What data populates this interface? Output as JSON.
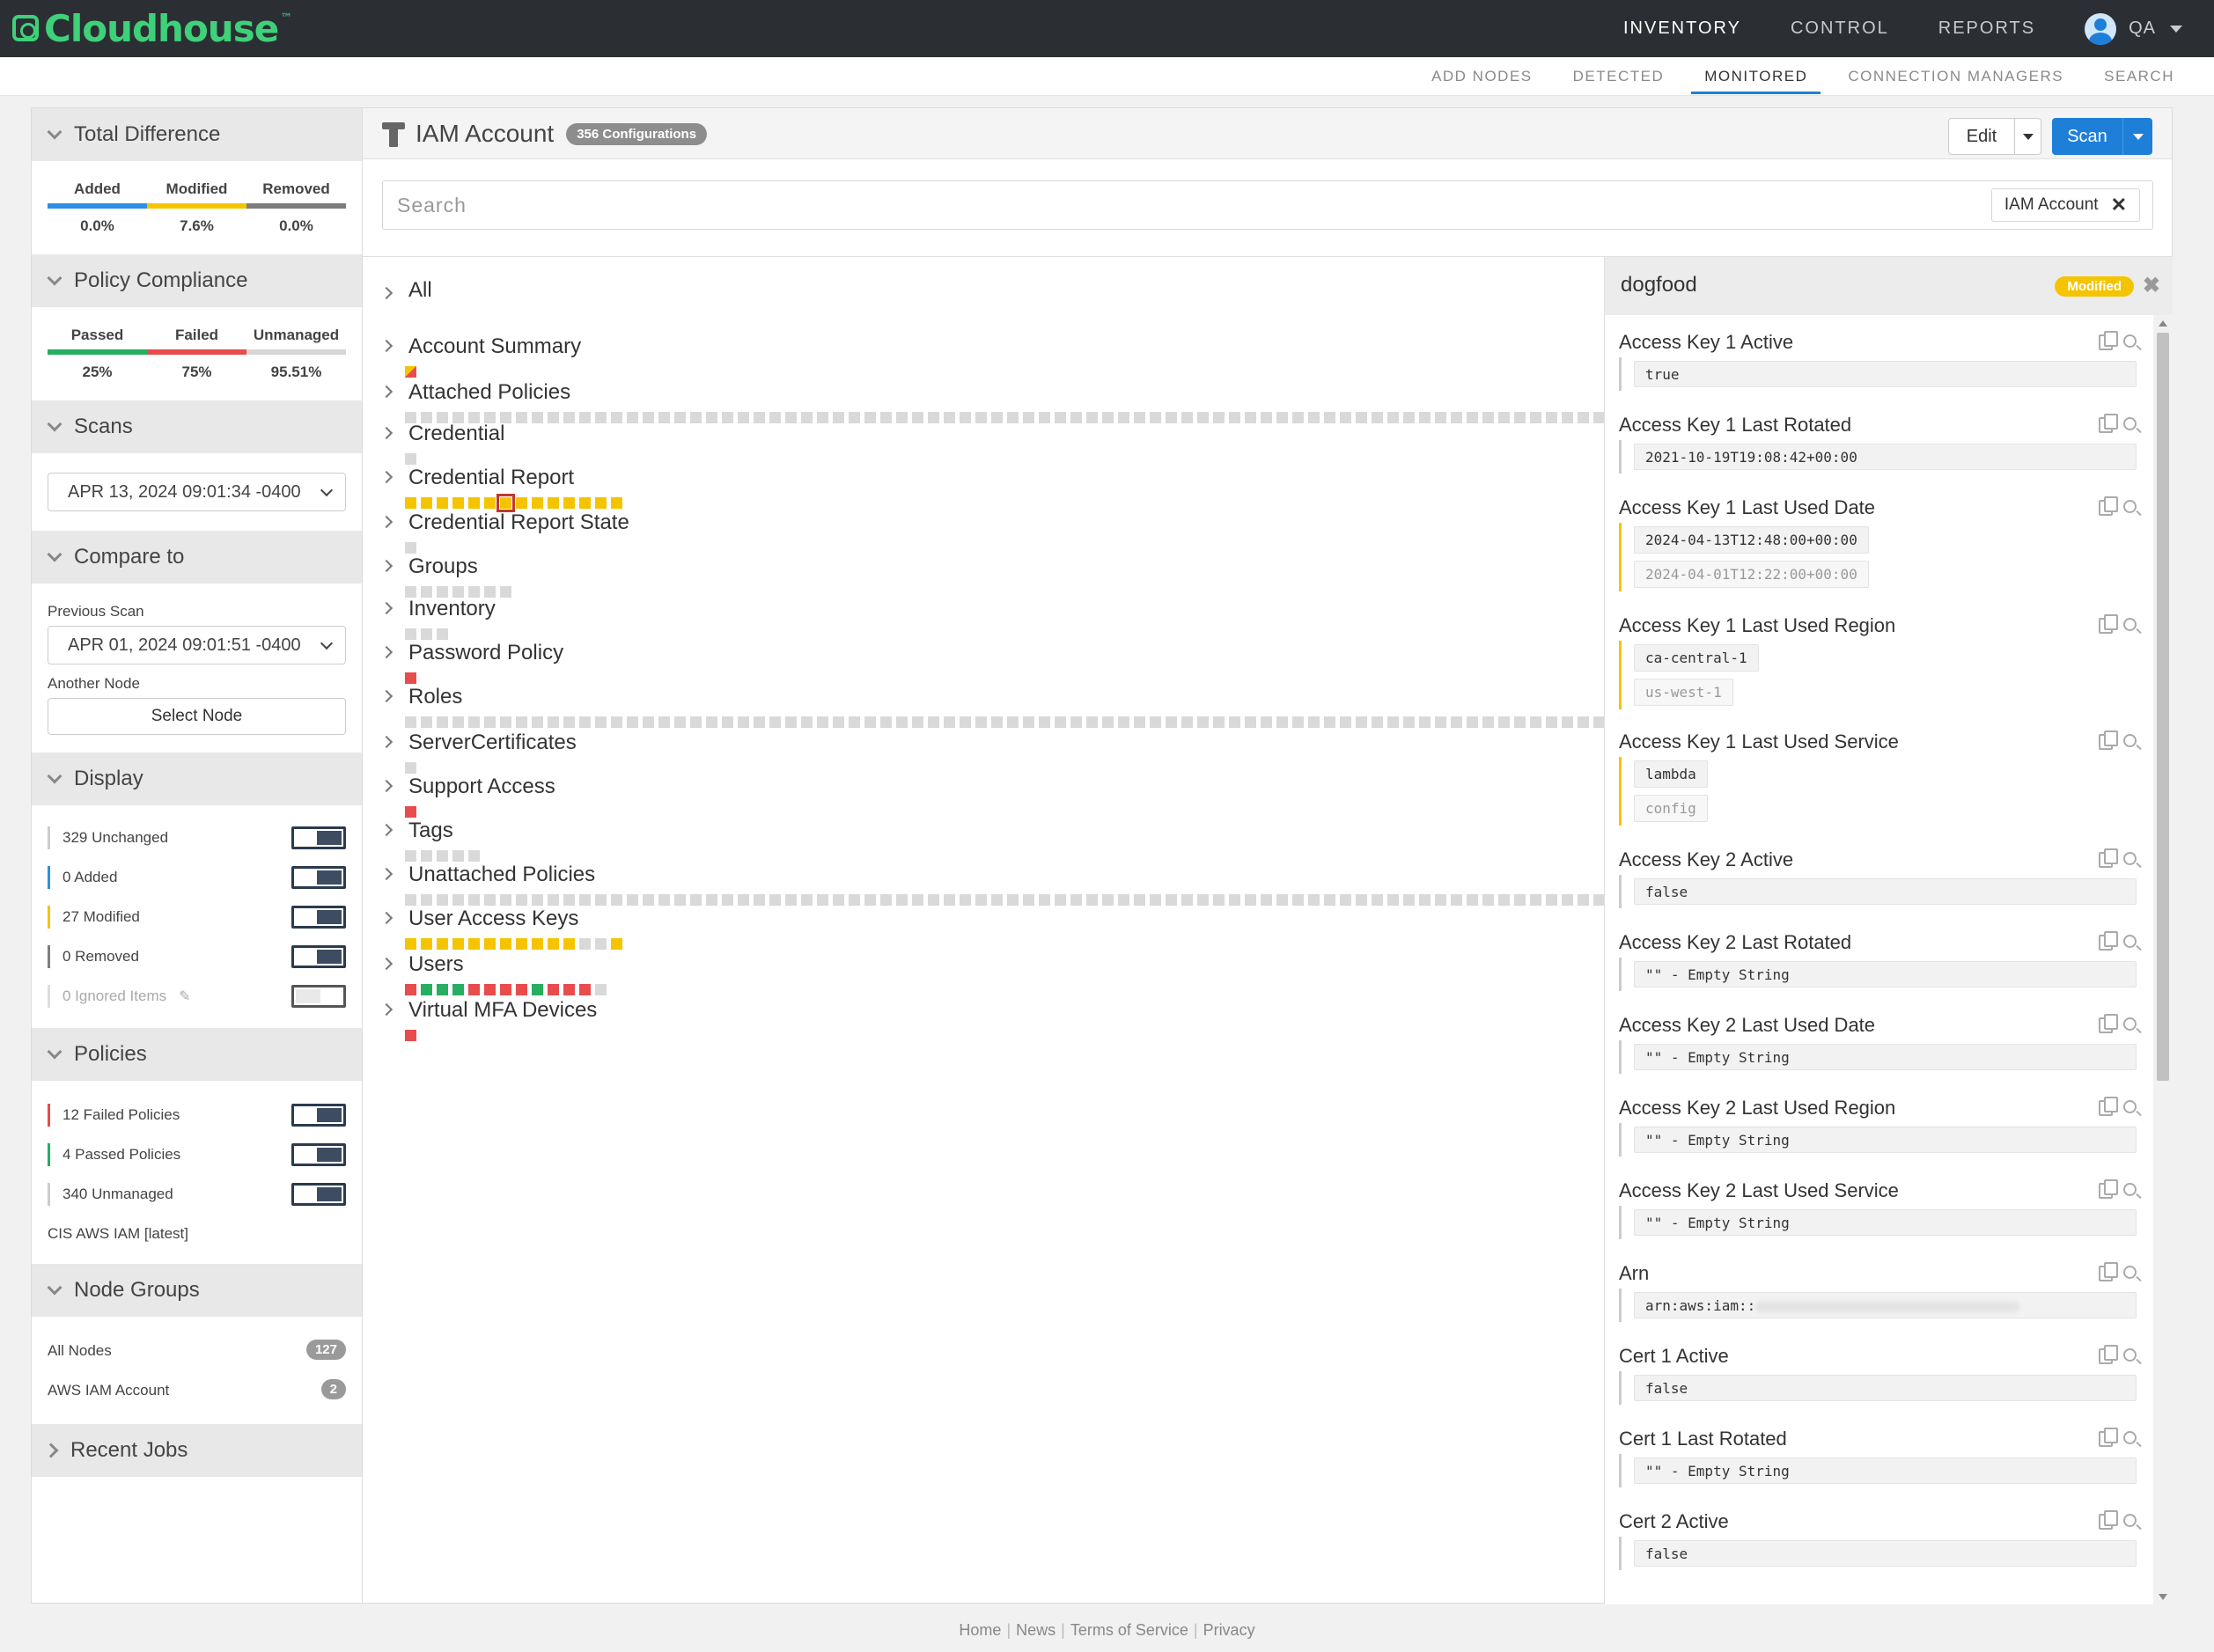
{
  "app": {
    "logo": "Cloudhouse",
    "logo_tm": "™"
  },
  "main_nav": [
    "INVENTORY",
    "CONTROL",
    "REPORTS"
  ],
  "main_nav_active": "INVENTORY",
  "user": {
    "name": "QA"
  },
  "sub_nav": [
    "ADD NODES",
    "DETECTED",
    "MONITORED",
    "CONNECTION MANAGERS",
    "SEARCH"
  ],
  "sub_nav_active": "MONITORED",
  "sidebar": {
    "total_difference": {
      "title": "Total Difference",
      "stats": [
        {
          "label": "Added",
          "value": "0.0%",
          "color": "#2d8fe3"
        },
        {
          "label": "Modified",
          "value": "7.6%",
          "color": "#f5c400"
        },
        {
          "label": "Removed",
          "value": "0.0%",
          "color": "#7d7d7d"
        }
      ]
    },
    "policy_compliance": {
      "title": "Policy Compliance",
      "stats": [
        {
          "label": "Passed",
          "value": "25%",
          "color": "#27ae60"
        },
        {
          "label": "Failed",
          "value": "75%",
          "color": "#e84c4c"
        },
        {
          "label": "Unmanaged",
          "value": "95.51%",
          "color": "#d6d6d6"
        }
      ]
    },
    "scans": {
      "title": "Scans",
      "selected": "APR 13, 2024 09:01:34 -0400"
    },
    "compare_to": {
      "title": "Compare to",
      "previous_scan_label": "Previous Scan",
      "previous_scan_value": "APR 01, 2024 09:01:51 -0400",
      "another_node_label": "Another Node",
      "select_node_label": "Select Node"
    },
    "display": {
      "title": "Display",
      "rows": [
        {
          "label": "329 Unchanged",
          "color": "#cccccc",
          "on": true
        },
        {
          "label": "0 Added",
          "color": "#2d8fe3",
          "on": true
        },
        {
          "label": "27 Modified",
          "color": "#f5c400",
          "on": true
        },
        {
          "label": "0 Removed",
          "color": "#7d7d7d",
          "on": true
        },
        {
          "label": "0 Ignored Items",
          "color": "#dddddd",
          "on": false
        }
      ]
    },
    "policies": {
      "title": "Policies",
      "rows": [
        {
          "label": "12 Failed Policies",
          "color": "#e84c4c",
          "on": true
        },
        {
          "label": "4 Passed Policies",
          "color": "#27ae60",
          "on": true
        },
        {
          "label": "340 Unmanaged",
          "color": "#cccccc",
          "on": true
        }
      ],
      "framework": "CIS AWS IAM [latest]"
    },
    "node_groups": {
      "title": "Node Groups",
      "rows": [
        {
          "label": "All Nodes",
          "count": "127"
        },
        {
          "label": "AWS IAM Account",
          "count": "2"
        }
      ]
    },
    "recent_jobs": {
      "title": "Recent Jobs"
    }
  },
  "main": {
    "title": "IAM Account",
    "config_badge": "356 Configurations",
    "edit_label": "Edit",
    "scan_label": "Scan",
    "search_placeholder": "Search",
    "filter_chip": "IAM Account",
    "tree": [
      {
        "name": "All",
        "squares": ""
      },
      {
        "name": "Account Summary",
        "squares": "R"
      },
      {
        "name": "Attached Policies",
        "squares": "gggggggggggggggggggggggggggggggggggggggggggggggggggggggggggggggggggggggggggggggggggggggggggggggggggg"
      },
      {
        "name": "Credential",
        "squares": "g"
      },
      {
        "name": "Credential Report",
        "squares": "yyyyyyXyyyyyyy"
      },
      {
        "name": "Credential Report State",
        "squares": "g"
      },
      {
        "name": "Groups",
        "squares": "ggggggg"
      },
      {
        "name": "Inventory",
        "squares": "ggg"
      },
      {
        "name": "Password Policy",
        "squares": "r"
      },
      {
        "name": "Roles",
        "squares": "ggggggggggggggggggggggggggggggggggggggggggggggggggggggggggggggggggggggggggggggggggggyggggggggggggggggg"
      },
      {
        "name": "ServerCertificates",
        "squares": "g"
      },
      {
        "name": "Support Access",
        "squares": "r"
      },
      {
        "name": "Tags",
        "squares": "ggggg"
      },
      {
        "name": "Unattached Policies",
        "squares": "gggggggggggggggggggggggggggggggggggggggggggggggggggggggggggggggggggggggggggggggggggggggggggggggggggggg"
      },
      {
        "name": "User Access Keys",
        "squares": "yyyyyyyyyyyggy"
      },
      {
        "name": "Users",
        "squares": "rGGGrrrrGrrrg"
      },
      {
        "name": "Virtual MFA Devices",
        "squares": "r"
      }
    ]
  },
  "detail": {
    "title": "dogfood",
    "status": "Modified",
    "attributes": [
      {
        "name": "Access Key 1 Active",
        "values": [
          "true"
        ],
        "modified": false
      },
      {
        "name": "Access Key 1 Last Rotated",
        "values": [
          "2021-10-19T19:08:42+00:00"
        ],
        "modified": false
      },
      {
        "name": "Access Key 1 Last Used Date",
        "values": [
          "2024-04-13T12:48:00+00:00",
          "2024-04-01T12:22:00+00:00"
        ],
        "modified": true
      },
      {
        "name": "Access Key 1 Last Used Region",
        "values": [
          "ca-central-1",
          "us-west-1"
        ],
        "modified": true
      },
      {
        "name": "Access Key 1 Last Used Service",
        "values": [
          "lambda",
          "config"
        ],
        "modified": true
      },
      {
        "name": "Access Key 2 Active",
        "values": [
          "false"
        ],
        "modified": false
      },
      {
        "name": "Access Key 2 Last Rotated",
        "values": [
          "\"\" - Empty String"
        ],
        "modified": false
      },
      {
        "name": "Access Key 2 Last Used Date",
        "values": [
          "\"\" - Empty String"
        ],
        "modified": false
      },
      {
        "name": "Access Key 2 Last Used Region",
        "values": [
          "\"\" - Empty String"
        ],
        "modified": false
      },
      {
        "name": "Access Key 2 Last Used Service",
        "values": [
          "\"\" - Empty String"
        ],
        "modified": false
      },
      {
        "name": "Arn",
        "values": [
          "arn:aws:iam::"
        ],
        "modified": false,
        "redacted": true
      },
      {
        "name": "Cert 1 Active",
        "values": [
          "false"
        ],
        "modified": false
      },
      {
        "name": "Cert 1 Last Rotated",
        "values": [
          "\"\" - Empty String"
        ],
        "modified": false
      },
      {
        "name": "Cert 2 Active",
        "values": [
          "false"
        ],
        "modified": false
      }
    ]
  },
  "footer": [
    "Home",
    "News",
    "Terms of Service",
    "Privacy"
  ],
  "colors": {
    "accent": "#1d7fd8",
    "brand": "#3fd17a",
    "modified": "#f5c400",
    "failed": "#e84c4c",
    "passed": "#27ae60",
    "unchanged": "#d9d9d9"
  }
}
